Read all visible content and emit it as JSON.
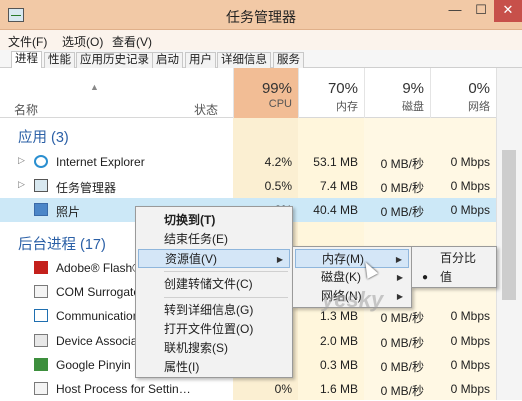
{
  "window": {
    "title": "任务管理器",
    "min": "—",
    "max": "☐",
    "close": "✕"
  },
  "menu": [
    "文件(F)",
    "选项(O)",
    "查看(V)"
  ],
  "tabs": [
    "进程",
    "性能",
    "应用历史记录",
    "启动",
    "用户",
    "详细信息",
    "服务"
  ],
  "columns": {
    "name": "名称",
    "status": "状态",
    "cpu": {
      "pct": "99%",
      "label": "CPU"
    },
    "memory": {
      "pct": "70%",
      "label": "内存"
    },
    "disk": {
      "pct": "9%",
      "label": "磁盘"
    },
    "network": {
      "pct": "0%",
      "label": "网络"
    }
  },
  "sections": {
    "apps": "应用 (3)",
    "background": "后台进程 (17)"
  },
  "app_rows": [
    {
      "name": "Internet Explorer",
      "icon": "ie-icon",
      "cpu": "4.2%",
      "memory": "53.1 MB",
      "disk": "0 MB/秒",
      "network": "0 Mbps"
    },
    {
      "name": "任务管理器",
      "icon": "task-manager-icon",
      "cpu": "0.5%",
      "memory": "7.4 MB",
      "disk": "0 MB/秒",
      "network": "0 Mbps"
    },
    {
      "name": "照片",
      "icon": "photos-icon",
      "cpu": "0%",
      "memory": "40.4 MB",
      "disk": "0 MB/秒",
      "network": "0 Mbps"
    }
  ],
  "bg_rows": [
    {
      "name": "Adobe® Flash®",
      "icon": "flash-icon",
      "cpu": "",
      "memory": "",
      "disk": "",
      "network": ""
    },
    {
      "name": "COM Surrogate",
      "icon": "com-icon",
      "cpu": "",
      "memory": "",
      "disk": "",
      "network": ""
    },
    {
      "name": "Communication",
      "icon": "mail-icon",
      "cpu": "",
      "memory": "1.3 MB",
      "disk": "0 MB/秒",
      "network": "0 Mbps"
    },
    {
      "name": "Device Associat",
      "icon": "device-icon",
      "cpu": "",
      "memory": "2.0 MB",
      "disk": "0 MB/秒",
      "network": "0 Mbps"
    },
    {
      "name": "Google Pinyin N",
      "icon": "pinyin-icon",
      "cpu": "",
      "memory": "0.3 MB",
      "disk": "0 MB/秒",
      "network": "0 Mbps"
    },
    {
      "name": "Host Process for Settin…",
      "icon": "host-icon",
      "cpu": "0%",
      "memory": "1.6 MB",
      "disk": "0 MB/秒",
      "network": "0 Mbps"
    }
  ],
  "context_menu": {
    "items": [
      "切换到(T)",
      "结束任务(E)",
      "资源值(V)",
      "创建转储文件(C)",
      "转到详细信息(G)",
      "打开文件位置(O)",
      "联机搜索(S)",
      "属性(I)"
    ]
  },
  "submenu": {
    "items": [
      "内存(M)",
      "磁盘(K)",
      "网络(N)"
    ]
  },
  "submenu2": {
    "items": [
      "百分比",
      "值"
    ],
    "selected": "值"
  },
  "watermark": "yesky"
}
